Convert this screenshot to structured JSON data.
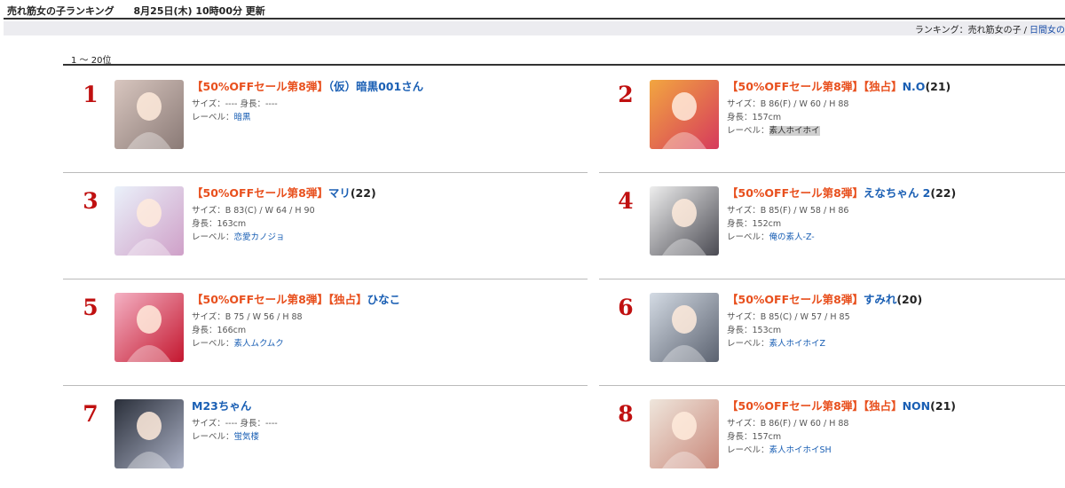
{
  "header": {
    "title": "売れ筋女の子ランキング",
    "updated": "8月25日(木) 10時00分 更新"
  },
  "breadcrumb": {
    "current": "ランキング：売れ筋女の子",
    "separator": "/",
    "link": "日間女の"
  },
  "range_label": "1 ～ 20位",
  "labels": {
    "size": "サイズ：",
    "height": "身長：",
    "label": "レーベル："
  },
  "items": [
    {
      "rank": "1",
      "tag": "【50%OFFセール第8弾】",
      "exclusive": "",
      "name": "（仮）暗黒001さん",
      "age": "",
      "size": "---- ",
      "height": "----",
      "height_inline": true,
      "label": "暗黒",
      "label_highlight": false,
      "thumb_colors": [
        "#d8c6bf",
        "#8a7a76"
      ]
    },
    {
      "rank": "2",
      "tag": "【50%OFFセール第8弾】",
      "exclusive": "【独占】",
      "name": "N.O",
      "age": "(21)",
      "size": "B 86(F) / W 60 / H 88",
      "height": "157cm",
      "height_inline": false,
      "label": "素人ホイホイ",
      "label_highlight": true,
      "thumb_colors": [
        "#f2a640",
        "#d63a5c"
      ]
    },
    {
      "rank": "3",
      "tag": "【50%OFFセール第8弾】",
      "exclusive": "",
      "name": "マリ",
      "age": "(22)",
      "size": "B 83(C) / W 64 / H 90",
      "height": "163cm",
      "height_inline": false,
      "label": "恋愛カノジョ",
      "label_highlight": false,
      "thumb_colors": [
        "#eaf1fa",
        "#cfa0c8"
      ]
    },
    {
      "rank": "4",
      "tag": "【50%OFFセール第8弾】",
      "exclusive": "",
      "name": "えなちゃん 2",
      "age": "(22)",
      "size": "B 85(F) / W 58 / H 86",
      "height": "152cm",
      "height_inline": false,
      "label": "俺の素人-Z-",
      "label_highlight": false,
      "thumb_colors": [
        "#eeeeee",
        "#4a4a52"
      ]
    },
    {
      "rank": "5",
      "tag": "【50%OFFセール第8弾】",
      "exclusive": "【独占】",
      "name": "ひなこ",
      "age": "",
      "size": "B 75 / W 56 / H 88",
      "height": "166cm",
      "height_inline": false,
      "label": "素人ムクムク",
      "label_highlight": false,
      "thumb_colors": [
        "#f4b2c4",
        "#c4172f"
      ]
    },
    {
      "rank": "6",
      "tag": "【50%OFFセール第8弾】",
      "exclusive": "",
      "name": "すみれ",
      "age": "(20)",
      "size": "B 85(C) / W 57 / H 85",
      "height": "153cm",
      "height_inline": false,
      "label": "素人ホイホイZ",
      "label_highlight": false,
      "thumb_colors": [
        "#d4dbe4",
        "#5b6270"
      ]
    },
    {
      "rank": "7",
      "tag": "",
      "exclusive": "",
      "name": "M23ちゃん",
      "age": "",
      "size": "---- ",
      "height": "----",
      "height_inline": true,
      "label": "蛍気楼",
      "label_highlight": false,
      "thumb_colors": [
        "#2a2f3a",
        "#aab0c4"
      ]
    },
    {
      "rank": "8",
      "tag": "【50%OFFセール第8弾】",
      "exclusive": "【独占】",
      "name": "NON",
      "age": "(21)",
      "size": "B 86(F) / W 60 / H 88",
      "height": "157cm",
      "height_inline": false,
      "label": "素人ホイホイSH",
      "label_highlight": false,
      "thumb_colors": [
        "#efe6dc",
        "#c9887a"
      ]
    }
  ]
}
